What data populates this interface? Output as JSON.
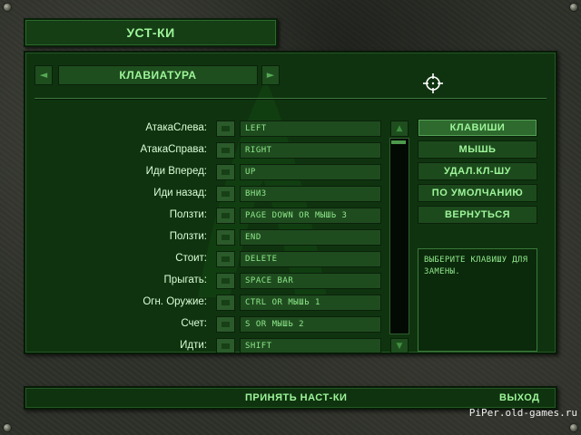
{
  "header": {
    "title": "УСТ-КИ"
  },
  "tab_bar": {
    "prev_arrow": "◄",
    "next_arrow": "►",
    "current_tab": "КЛАВИАТУРА"
  },
  "keybindings": [
    {
      "action": "АтакаСлева:",
      "key": "LEFT"
    },
    {
      "action": "АтакаСправа:",
      "key": "RIGHT"
    },
    {
      "action": "Иди Вперед:",
      "key": "UP"
    },
    {
      "action": "Иди назад:",
      "key": "ВНИЗ"
    },
    {
      "action": "Ползти:",
      "key": "PAGE DOWN OR МЫШЬ 3"
    },
    {
      "action": "Ползти:",
      "key": "END"
    },
    {
      "action": "Стоит:",
      "key": "DELETE"
    },
    {
      "action": "Прыгать:",
      "key": "SPACE BAR"
    },
    {
      "action": "Огн. Оружие:",
      "key": "CTRL OR МЫШЬ 1"
    },
    {
      "action": "Счет:",
      "key": "S OR МЫШЬ 2"
    },
    {
      "action": "Идти:",
      "key": "SHIFT"
    }
  ],
  "scrollbar": {
    "up_arrow": "▲",
    "down_arrow": "▼",
    "position": 0.0
  },
  "side_menu": {
    "buttons": [
      "КЛАВИШИ",
      "МЫШЬ",
      "УДАЛ.КЛ-ШУ",
      "ПО УМОЛЧАНИЮ",
      "ВЕРНУТЬСЯ"
    ],
    "active_index": 0
  },
  "info_box": {
    "text": "ВЫБЕРИТЕ КЛАВИШУ ДЛЯ ЗАМЕНЫ."
  },
  "footer": {
    "apply_label": "ПРИНЯТЬ НАСТ-КИ",
    "exit_label": "ВЫХОД"
  },
  "watermark_text": "PiPer.old-games.ru",
  "colors": {
    "panel_green": "#0f330f",
    "text_bright": "#9ef59a",
    "label_text": "#d9ffd6"
  }
}
